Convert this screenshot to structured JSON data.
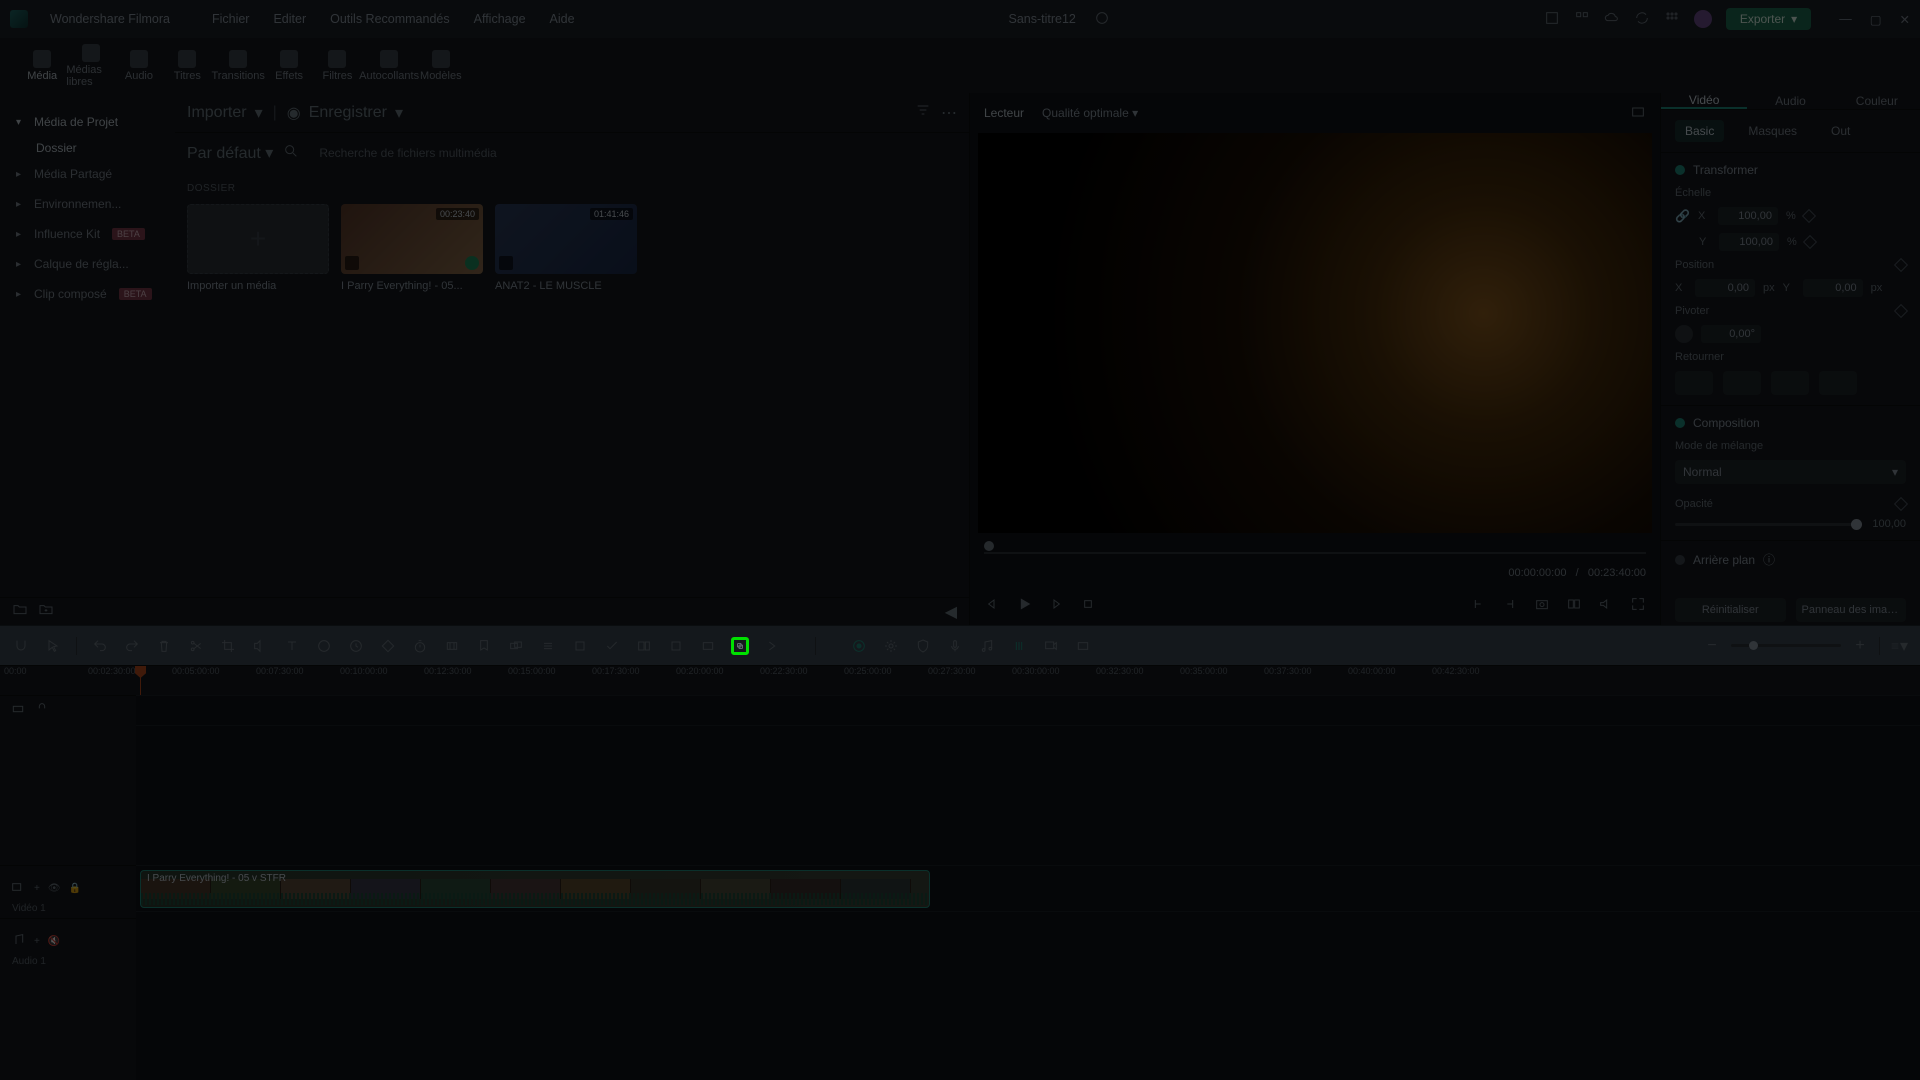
{
  "app_name": "Wondershare Filmora",
  "menu": [
    "Fichier",
    "Editer",
    "Outils Recommandés",
    "Affichage",
    "Aide"
  ],
  "project_title": "Sans-titre12",
  "export_label": "Exporter",
  "top_tabs": [
    {
      "label": "Média"
    },
    {
      "label": "Médias libres"
    },
    {
      "label": "Audio"
    },
    {
      "label": "Titres"
    },
    {
      "label": "Transitions"
    },
    {
      "label": "Effets"
    },
    {
      "label": "Filtres"
    },
    {
      "label": "Autocollants"
    },
    {
      "label": "Modèles"
    }
  ],
  "import_label": "Importer",
  "save_label": "Enregistrer",
  "sort_label": "Par défaut",
  "search_placeholder": "Recherche de fichiers multimédia",
  "folder_label": "DOSSIER",
  "tree": [
    {
      "label": "Média de Projet",
      "expanded": true,
      "sub": "Dossier"
    },
    {
      "label": "Média Partagé"
    },
    {
      "label": "Environnemen..."
    },
    {
      "label": "Influence Kit",
      "badge": "BETA"
    },
    {
      "label": "Calque de régla..."
    },
    {
      "label": "Clip composé",
      "badge": "BETA"
    }
  ],
  "import_cell_label": "Importer un média",
  "clips": [
    {
      "name": "I Parry Everything! - 05...",
      "duration": "00:23:40"
    },
    {
      "name": "ANAT2 - LE MUSCLE",
      "duration": "01:41:46"
    }
  ],
  "preview": {
    "player_label": "Lecteur",
    "quality_label": "Qualité optimale",
    "current_time": "00:00:00:00",
    "total_time": "00:23:40:00",
    "sep": "/"
  },
  "inspector": {
    "tabs": [
      "Vidéo",
      "Audio",
      "Couleur"
    ],
    "subtabs": [
      "Basic",
      "Masques",
      "Out"
    ],
    "transformer": "Transformer",
    "scale": {
      "label": "Échelle",
      "x": "100,00",
      "y": "100,00",
      "unit": "%"
    },
    "position": {
      "label": "Position",
      "x": "0,00",
      "y": "0,00",
      "unit": "px"
    },
    "rotate": {
      "label": "Pivoter",
      "val": "0,00°"
    },
    "flip": "Retourner",
    "composition": "Composition",
    "blend": {
      "label": "Mode de mélange",
      "val": "Normal"
    },
    "opacity": {
      "label": "Opacité",
      "val": "100,00"
    },
    "background": "Arrière plan",
    "reset": "Réinitialiser",
    "snapshot": "Panneau des imag..."
  },
  "ruler_ticks": [
    "00:00",
    "00:02:30:00",
    "00:05:00:00",
    "00:07:30:00",
    "00:10:00:00",
    "00:12:30:00",
    "00:15:00:00",
    "00:17:30:00",
    "00:20:00:00",
    "00:22:30:00",
    "00:25:00:00",
    "00:27:30:00",
    "00:30:00:00",
    "00:32:30:00",
    "00:35:00:00",
    "00:37:30:00",
    "00:40:00:00",
    "00:42:30:00"
  ],
  "timeline_clip_label": "I Parry Everything! - 05  v  STFR",
  "track_video_label": "Vidéo 1",
  "track_audio_label": "Audio 1"
}
